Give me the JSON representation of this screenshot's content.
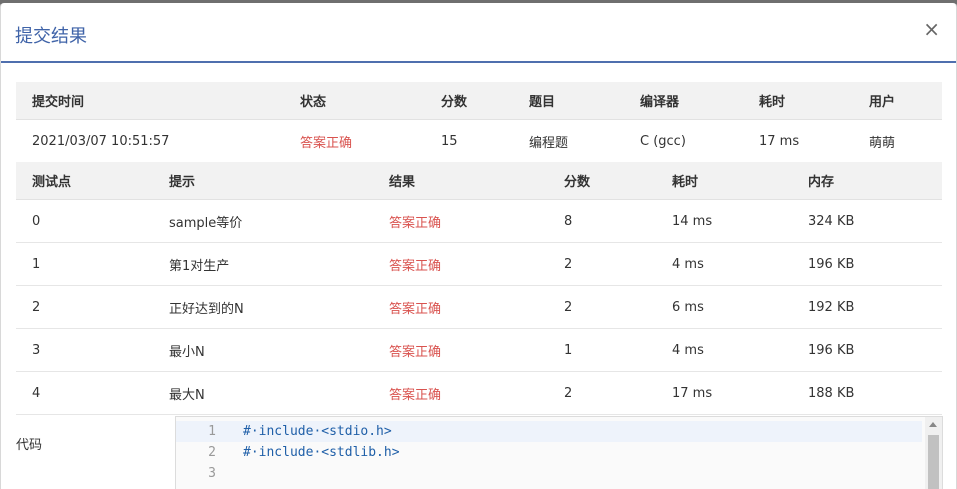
{
  "modal": {
    "title": "提交结果",
    "close_glyph": "×"
  },
  "summary": {
    "headers": [
      "提交时间",
      "状态",
      "分数",
      "题目",
      "编译器",
      "耗时",
      "用户"
    ],
    "row": [
      "2021/03/07 10:51:57",
      "答案正确",
      "15",
      "编程题",
      "C (gcc)",
      "17 ms",
      "萌萌"
    ]
  },
  "cases": {
    "headers": [
      "测试点",
      "提示",
      "结果",
      "分数",
      "耗时",
      "内存"
    ],
    "rows": [
      [
        "0",
        "sample等价",
        "答案正确",
        "8",
        "14 ms",
        "324 KB"
      ],
      [
        "1",
        "第1对生产",
        "答案正确",
        "2",
        "4 ms",
        "196 KB"
      ],
      [
        "2",
        "正好达到的N",
        "答案正确",
        "2",
        "6 ms",
        "192 KB"
      ],
      [
        "3",
        "最小N",
        "答案正确",
        "1",
        "4 ms",
        "196 KB"
      ],
      [
        "4",
        "最大N",
        "答案正确",
        "2",
        "17 ms",
        "188 KB"
      ]
    ]
  },
  "code": {
    "label": "代码",
    "lines": [
      {
        "num": "1",
        "text": "#·include·<stdio.h>"
      },
      {
        "num": "2",
        "text": "#·include·<stdlib.h>"
      },
      {
        "num": "3",
        "text": ""
      }
    ]
  },
  "colors": {
    "accent": "#3f63a8",
    "ok": "#d9534f",
    "header_bg": "#f2f2f2"
  }
}
